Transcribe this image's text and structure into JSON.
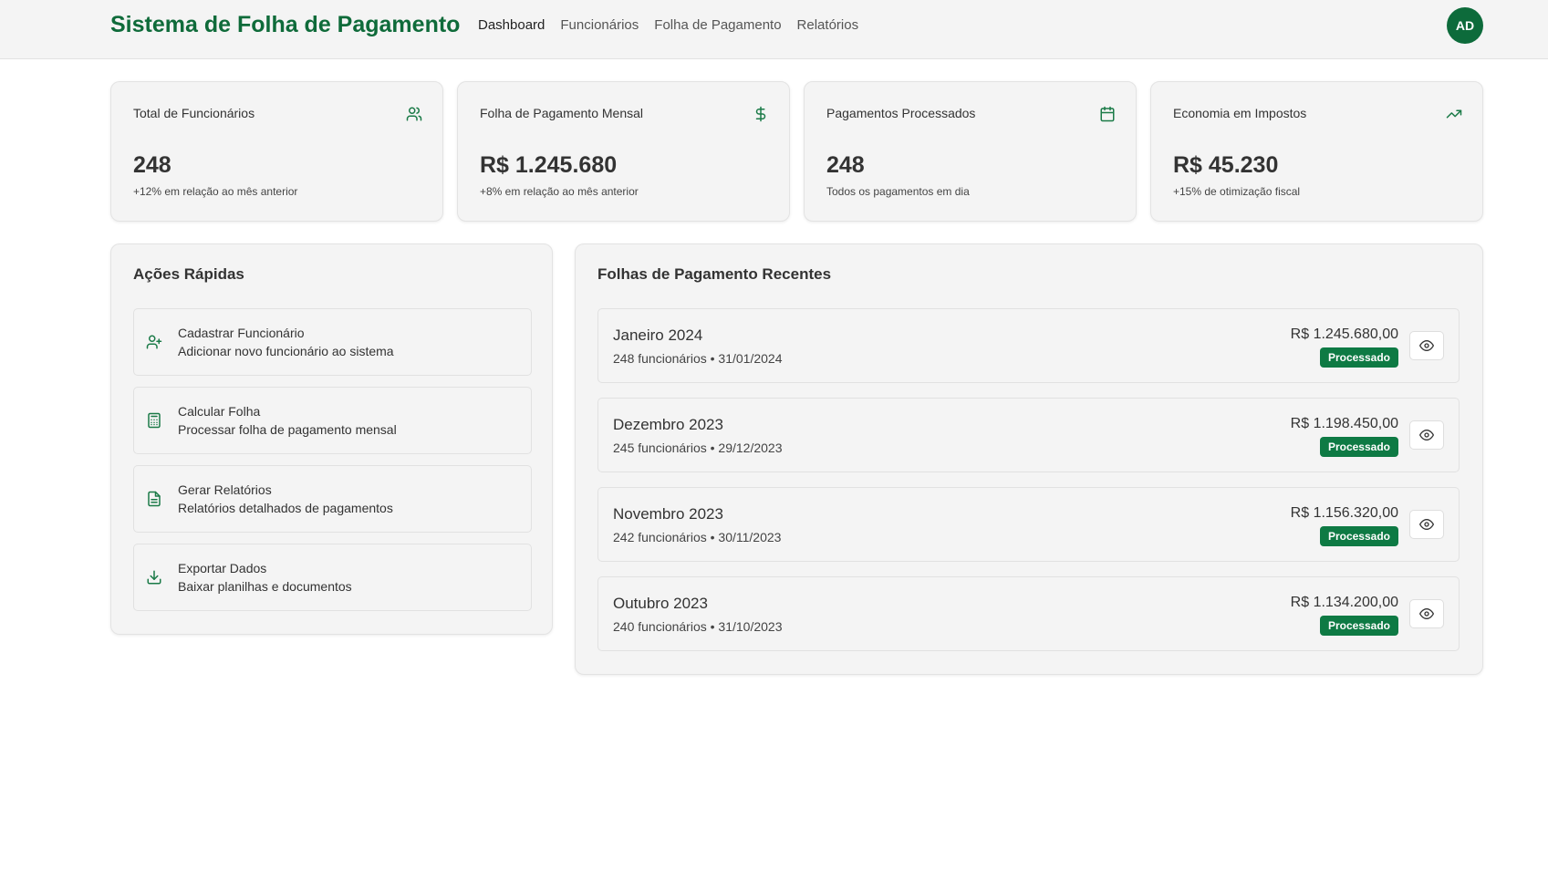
{
  "header": {
    "brand": "Sistema de Folha de Pagamento",
    "nav": [
      "Dashboard",
      "Funcionários",
      "Folha de Pagamento",
      "Relatórios"
    ],
    "avatar_initials": "AD"
  },
  "stats": [
    {
      "label": "Total de Funcionários",
      "value": "248",
      "sub": "+12% em relação ao mês anterior",
      "icon": "users-icon"
    },
    {
      "label": "Folha de Pagamento Mensal",
      "value": "R$ 1.245.680",
      "sub": "+8% em relação ao mês anterior",
      "icon": "dollar-icon"
    },
    {
      "label": "Pagamentos Processados",
      "value": "248",
      "sub": "Todos os pagamentos em dia",
      "icon": "calendar-icon"
    },
    {
      "label": "Economia em Impostos",
      "value": "R$ 45.230",
      "sub": "+15% de otimização fiscal",
      "icon": "trending-up-icon"
    }
  ],
  "quick_actions": {
    "title": "Ações Rápidas",
    "items": [
      {
        "title": "Cadastrar Funcionário",
        "desc": "Adicionar novo funcionário ao sistema",
        "icon": "user-plus-icon"
      },
      {
        "title": "Calcular Folha",
        "desc": "Processar folha de pagamento mensal",
        "icon": "calculator-icon"
      },
      {
        "title": "Gerar Relatórios",
        "desc": "Relatórios detalhados de pagamentos",
        "icon": "file-text-icon"
      },
      {
        "title": "Exportar Dados",
        "desc": "Baixar planilhas e documentos",
        "icon": "download-icon"
      }
    ]
  },
  "recent": {
    "title": "Folhas de Pagamento Recentes",
    "items": [
      {
        "month": "Janeiro 2024",
        "info": "248 funcionários • 31/01/2024",
        "amount": "R$ 1.245.680,00",
        "status": "Processado"
      },
      {
        "month": "Dezembro 2023",
        "info": "245 funcionários • 29/12/2023",
        "amount": "R$ 1.198.450,00",
        "status": "Processado"
      },
      {
        "month": "Novembro 2023",
        "info": "242 funcionários • 30/11/2023",
        "amount": "R$ 1.156.320,00",
        "status": "Processado"
      },
      {
        "month": "Outubro 2023",
        "info": "240 funcionários • 31/10/2023",
        "amount": "R$ 1.134.200,00",
        "status": "Processado"
      }
    ]
  },
  "colors": {
    "brand": "#0f6b3a",
    "badge": "#0e7a44",
    "icon": "#1a7a47"
  }
}
